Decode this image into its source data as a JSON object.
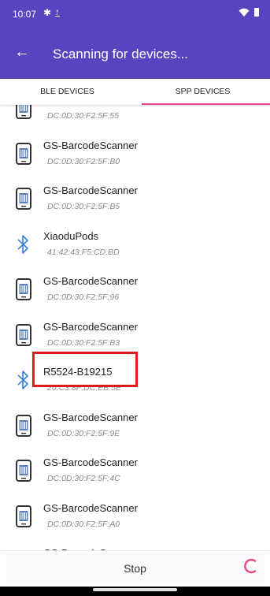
{
  "status": {
    "time": "10:07",
    "bt_glyph": "✱",
    "upload_glyph": "↑"
  },
  "appbar": {
    "title": "Scanning for devices..."
  },
  "tabs": [
    {
      "label": "BLE DEVICES",
      "selected": false
    },
    {
      "label": "SPP DEVICES",
      "selected": true
    }
  ],
  "devices": [
    {
      "name": "",
      "address": "DC:0D:30:F2:5F:55",
      "icon": "barcode-scanner-icon"
    },
    {
      "name": "GS-BarcodeScanner",
      "address": "DC:0D:30:F2:5F:B0",
      "icon": "barcode-scanner-icon"
    },
    {
      "name": "GS-BarcodeScanner",
      "address": "DC:0D:30:F2:5F:B5",
      "icon": "barcode-scanner-icon"
    },
    {
      "name": "XiaoduPods",
      "address": "41:42:43:F5:CD:BD",
      "icon": "bluetooth-icon"
    },
    {
      "name": "GS-BarcodeScanner",
      "address": "DC:0D:30:F2:5F:96",
      "icon": "barcode-scanner-icon"
    },
    {
      "name": "GS-BarcodeScanner",
      "address": "DC:0D:30:F2:5F:B3",
      "icon": "barcode-scanner-icon"
    },
    {
      "name": "R5524-B19215",
      "address": "20:C3:8F:DC:EB:5E",
      "icon": "bluetooth-icon"
    },
    {
      "name": "GS-BarcodeScanner",
      "address": "DC:0D:30:F2:5F:9E",
      "icon": "barcode-scanner-icon"
    },
    {
      "name": "GS-BarcodeScanner",
      "address": "DC:0D:30:F2:5F:4C",
      "icon": "barcode-scanner-icon"
    },
    {
      "name": "GS-BarcodeScanner",
      "address": "DC:0D:30:F2:5F:A0",
      "icon": "barcode-scanner-icon"
    },
    {
      "name": "GS-BarcodeScanner",
      "address": "",
      "icon": "barcode-scanner-icon"
    }
  ],
  "bottom": {
    "stop_label": "Stop"
  },
  "colors": {
    "primary": "#5a43bf",
    "accent": "#e64a8a",
    "highlight": "#e01a1a",
    "bluetooth": "#3a7be0"
  }
}
